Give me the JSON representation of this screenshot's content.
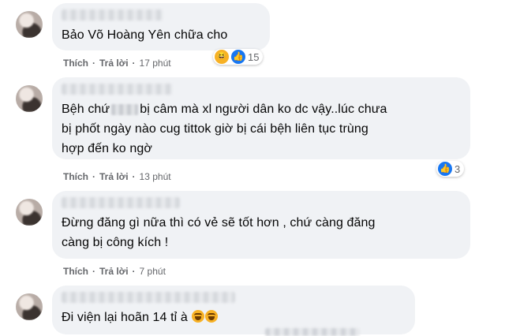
{
  "comments": [
    {
      "text": "Bảo Võ Hoàng Yên chữa cho",
      "actions": {
        "like": "Thích",
        "reply": "Trả lời",
        "time": "17 phút"
      },
      "reaction_count": "15",
      "reactions": [
        "haha-icon",
        "like-icon"
      ]
    },
    {
      "text_part1": "Bệh chứ",
      "text_part2": "bị câm mà xl người dân ko dc vậy..lúc chưa",
      "text_line2": "bị phốt ngày nào cug tittok giờ bị cái bệh liên tục trùng",
      "text_line3": "hợp đến ko ngờ",
      "actions": {
        "like": "Thích",
        "reply": "Trả lời",
        "time": "13 phút"
      },
      "reaction_count": "3",
      "reactions": [
        "like-icon"
      ]
    },
    {
      "text_line1": "Đừng đăng gì nữa thì có vẻ sẽ tốt hơn , chứ càng đăng",
      "text_line2": "càng bị công kích !",
      "actions": {
        "like": "Thích",
        "reply": "Trả lời",
        "time": "7 phút"
      }
    },
    {
      "text": "Đi viện lại hoãn 14 tỉ à",
      "emojis": [
        "laughing-emoji",
        "laughing-emoji"
      ]
    }
  ],
  "colors": {
    "bubble": "#f0f2f5",
    "meta_text": "#65676b",
    "like_blue": "#1877f2",
    "haha_yellow": "#f7b125"
  }
}
